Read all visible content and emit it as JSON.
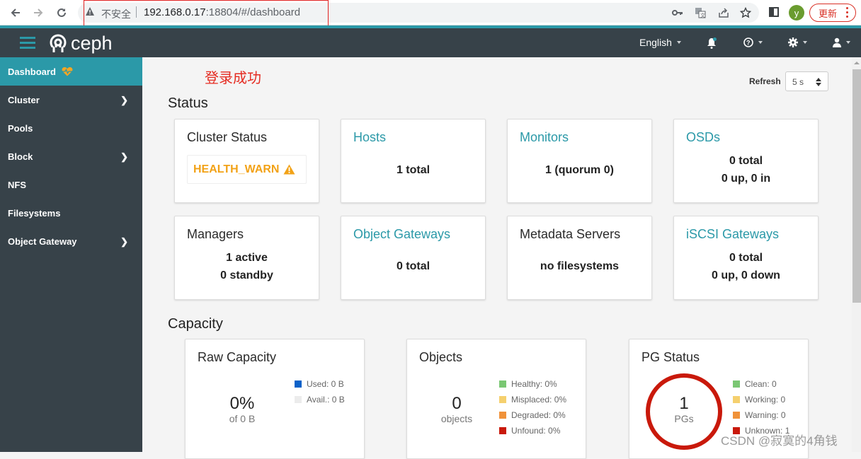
{
  "browser": {
    "security_label": "不安全",
    "url_host": "192.168.0.17",
    "url_rest": ":18804/#/dashboard",
    "profile_initial": "y",
    "update_label": "更新",
    "icons": [
      "back-icon",
      "forward-icon",
      "reload-icon",
      "warning-icon",
      "key-icon",
      "translate-icon",
      "share-icon",
      "star-icon",
      "side-panel-icon",
      "menu-dots-icon"
    ]
  },
  "topnav": {
    "brand": "ceph",
    "language": "English",
    "icons": [
      "hamburger-icon",
      "bell-icon",
      "help-icon",
      "gear-icon",
      "user-icon"
    ]
  },
  "sidebar": {
    "items": [
      {
        "label": "Dashboard",
        "active": true,
        "has_submenu": false
      },
      {
        "label": "Cluster",
        "active": false,
        "has_submenu": true
      },
      {
        "label": "Pools",
        "active": false,
        "has_submenu": false
      },
      {
        "label": "Block",
        "active": false,
        "has_submenu": true
      },
      {
        "label": "NFS",
        "active": false,
        "has_submenu": false
      },
      {
        "label": "Filesystems",
        "active": false,
        "has_submenu": false
      },
      {
        "label": "Object Gateway",
        "active": false,
        "has_submenu": true
      }
    ]
  },
  "annotation": "登录成功",
  "refresh": {
    "label": "Refresh",
    "value": "5 s"
  },
  "status": {
    "title": "Status",
    "cards": {
      "cluster_status": {
        "title": "Cluster Status",
        "value": "HEALTH_WARN"
      },
      "hosts": {
        "title": "Hosts",
        "line1": "1 total"
      },
      "monitors": {
        "title": "Monitors",
        "line1": "1 (quorum 0)"
      },
      "osds": {
        "title": "OSDs",
        "line1": "0 total",
        "line2": "0 up, 0 in"
      },
      "managers": {
        "title": "Managers",
        "line1": "1 active",
        "line2": "0 standby"
      },
      "object_gateways": {
        "title": "Object Gateways",
        "line1": "0 total"
      },
      "metadata_servers": {
        "title": "Metadata Servers",
        "line1": "no filesystems"
      },
      "iscsi_gateways": {
        "title": "iSCSI Gateways",
        "line1": "0 total",
        "line2": "0 up, 0 down"
      }
    }
  },
  "capacity": {
    "title": "Capacity",
    "raw_capacity": {
      "title": "Raw Capacity",
      "percent": "0%",
      "sub": "of 0 B",
      "legend": [
        {
          "label": "Used: 0 B",
          "color": "#0b62c9"
        },
        {
          "label": "Avail.: 0 B",
          "color": "#ececec"
        }
      ]
    },
    "objects": {
      "title": "Objects",
      "count": "0",
      "sub": "objects",
      "legend": [
        {
          "label": "Healthy: 0%",
          "color": "#7ac773"
        },
        {
          "label": "Misplaced: 0%",
          "color": "#f5d06e"
        },
        {
          "label": "Degraded: 0%",
          "color": "#f0923a"
        },
        {
          "label": "Unfound: 0%",
          "color": "#c9190b"
        }
      ]
    },
    "pg_status": {
      "title": "PG Status",
      "count": "1",
      "sub": "PGs",
      "ring_color": "#c9190b",
      "legend": [
        {
          "label": "Clean: 0",
          "color": "#7ac773"
        },
        {
          "label": "Working: 0",
          "color": "#f5d06e"
        },
        {
          "label": "Warning: 0",
          "color": "#f0923a"
        },
        {
          "label": "Unknown: 1",
          "color": "#c9190b"
        }
      ]
    }
  },
  "watermark": "CSDN @寂寞的4角钱",
  "colors": {
    "accent": "#2b99a8",
    "nav_bg": "#374249",
    "warn": "#f2a217"
  }
}
